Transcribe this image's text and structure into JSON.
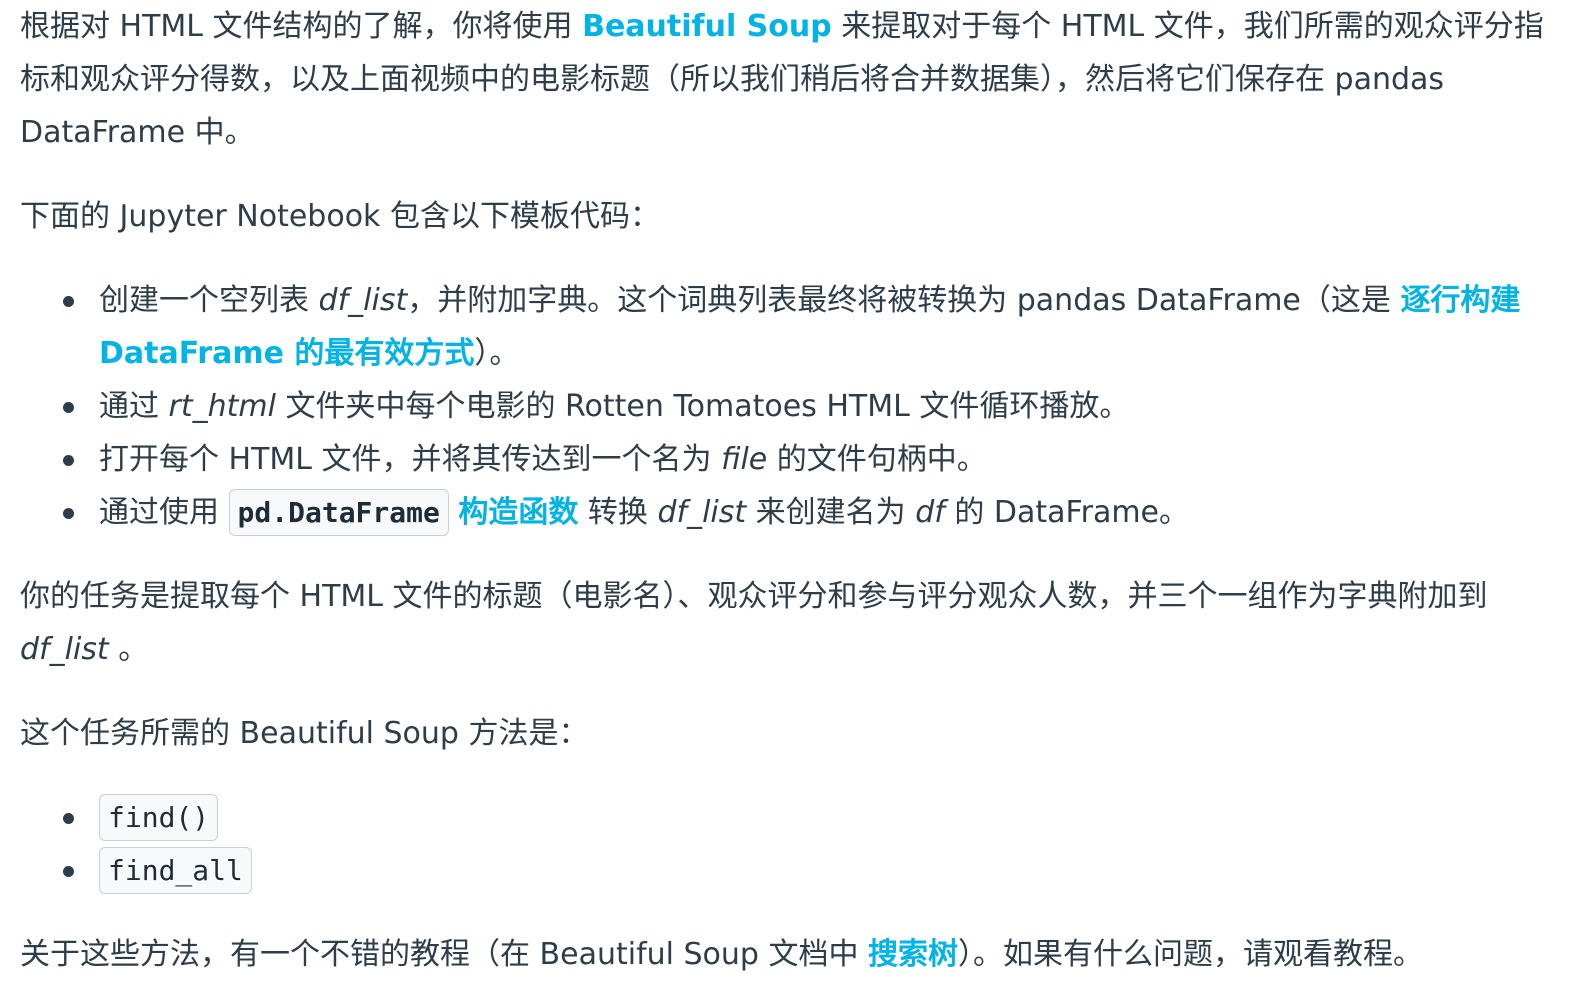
{
  "para1": {
    "t1": "根据对 HTML 文件结构的了解，你将使用 ",
    "link_bs": "Beautiful Soup",
    "t2": " 来提取对于每个 HTML 文件，我们所需的观众评分指标和观众评分得数，以及上面视频中的电影标题（所以我们稍后将合并数据集），然后将它们保存在 pandas DataFrame 中。"
  },
  "para2": "下面的 Jupyter Notebook 包含以下模板代码：",
  "list1": {
    "item1": {
      "t1": "创建一个空列表 ",
      "em1": "df_list",
      "t2": "，并附加字典。这个词典列表最终将被转换为 pandas DataFrame（这是 ",
      "link": "逐行构建 DataFrame 的最有效方式",
      "t3": "）。"
    },
    "item2": {
      "t1": "通过 ",
      "em1": "rt_html",
      "t2": " 文件夹中每个电影的 Rotten Tomatoes HTML 文件循环播放。"
    },
    "item3": {
      "t1": "打开每个 HTML 文件，并将其传达到一个名为 ",
      "em1": "file",
      "t2": " 的文件句柄中。"
    },
    "item4": {
      "t1": "通过使用 ",
      "code": "pd.DataFrame",
      "link": "构造函数",
      "t2": " 转换 ",
      "em1": "df_list",
      "t3": " 来创建名为 ",
      "em2": "df",
      "t4": " 的 DataFrame。"
    }
  },
  "para3": {
    "t1": "你的任务是提取每个 HTML 文件的标题（电影名）、观众评分和参与评分观众人数，并三个一组作为字典附加到 ",
    "em1": "df_list",
    "t2": " 。"
  },
  "para4": "这个任务所需的 Beautiful Soup 方法是：",
  "list2": [
    "find()",
    "find_all"
  ],
  "para5": {
    "t1": "关于这些方法，有一个不错的教程（在 Beautiful Soup 文档中 ",
    "link": "搜索树",
    "t2": "）。如果有什么问题，请观看教程。"
  },
  "colors": {
    "text": "#2e3d49",
    "link": "#02b3e4",
    "code_bg": "#f7f9fb",
    "code_border": "#c9d1d8"
  }
}
